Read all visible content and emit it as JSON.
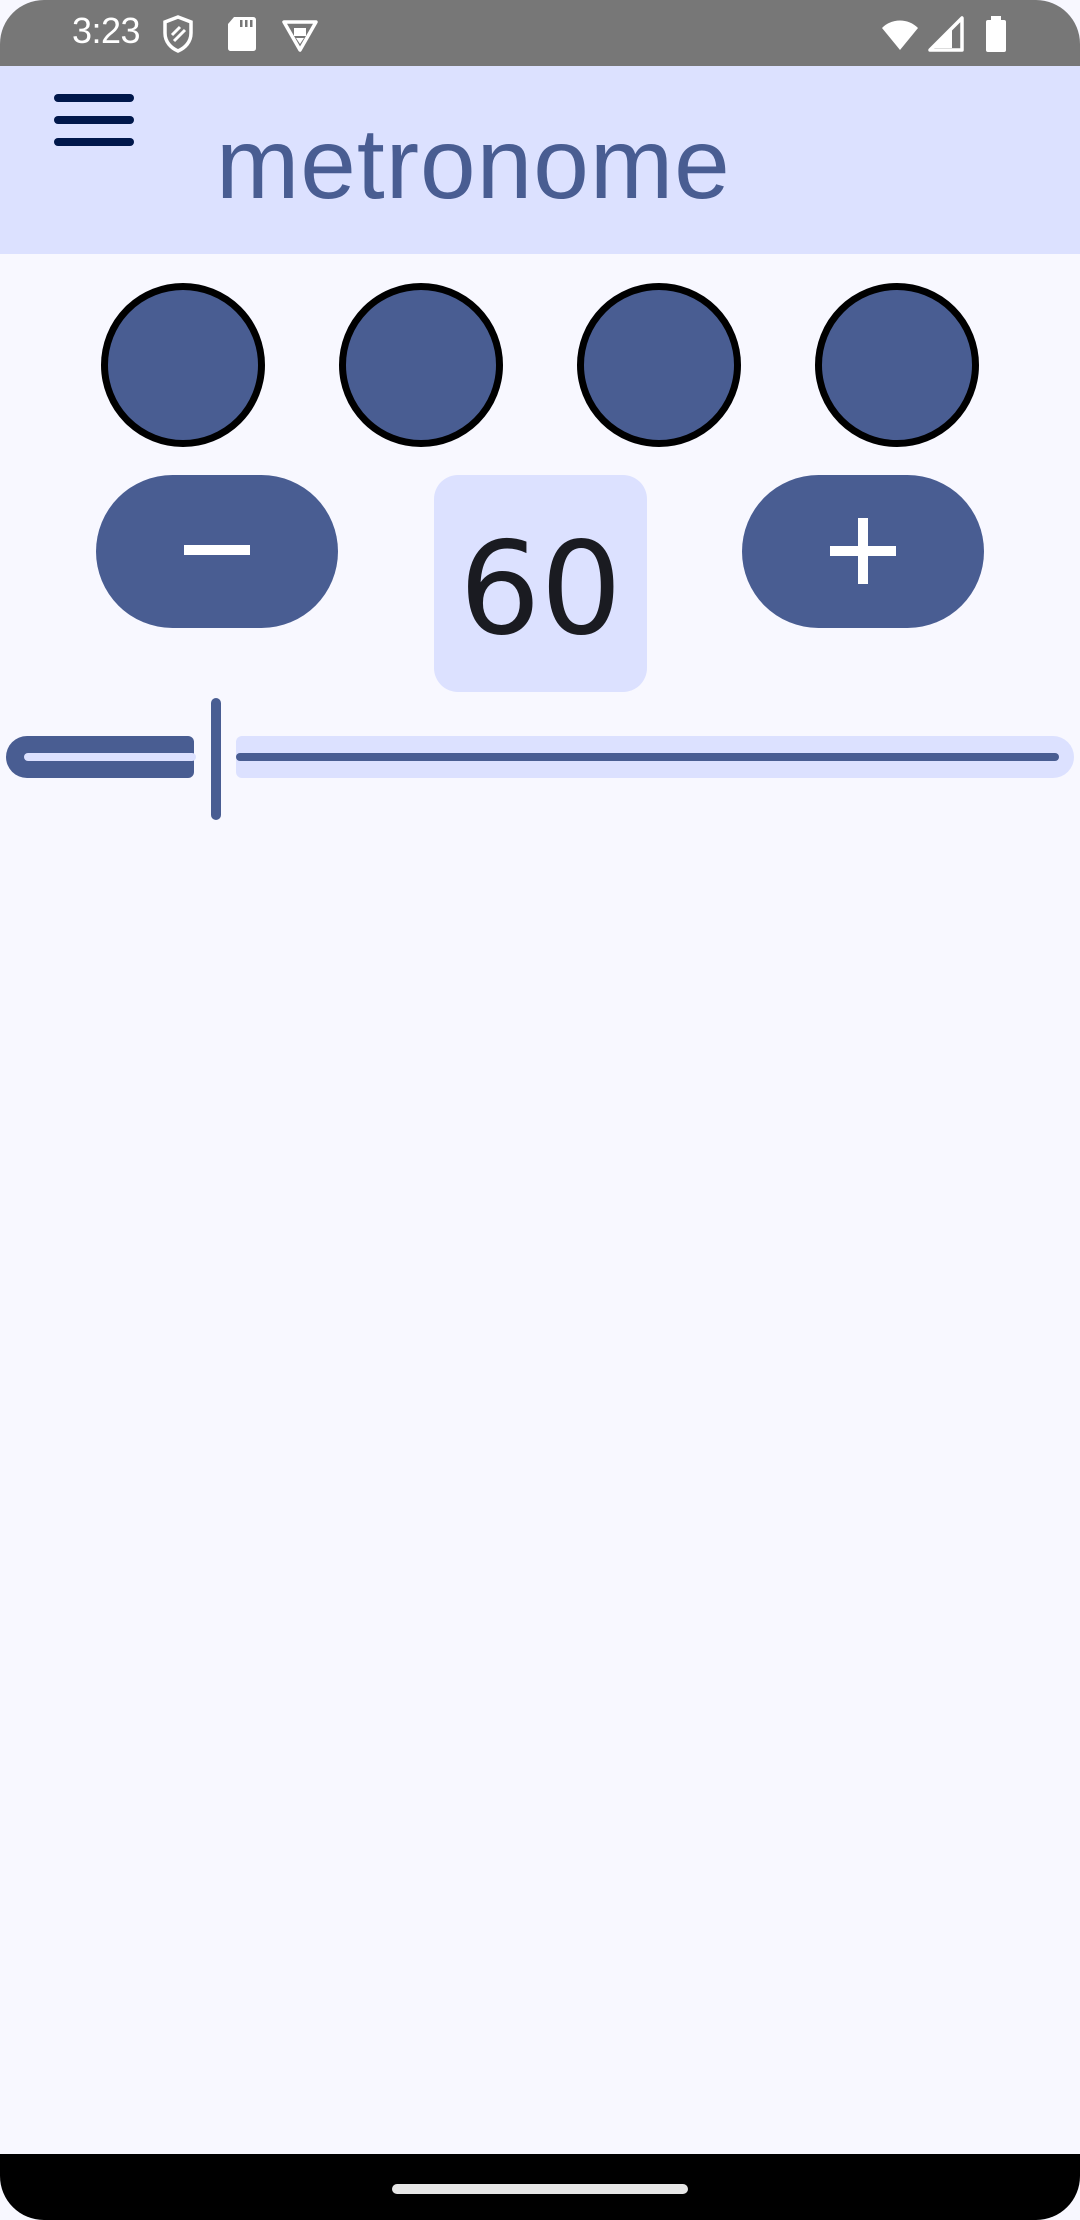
{
  "status_bar": {
    "time": "3:23",
    "icons": [
      "shield-icon",
      "sd-card-icon",
      "vpn-icon",
      "wifi-icon",
      "signal-icon",
      "battery-icon"
    ]
  },
  "app_bar": {
    "menu_icon": "menu-icon",
    "title": "metronome"
  },
  "beats": {
    "count": 4,
    "color": "#495d92",
    "outline": "#000000"
  },
  "controls": {
    "decrement_icon": "minus-icon",
    "increment_icon": "plus-icon",
    "bpm": "60"
  },
  "slider": {
    "level_fraction": 0.2
  },
  "colors": {
    "primary": "#495d92",
    "primary_container": "#dce1ff",
    "background": "#f8f8ff",
    "on_primary_container": "#00174b",
    "status_bar": "#777777"
  }
}
